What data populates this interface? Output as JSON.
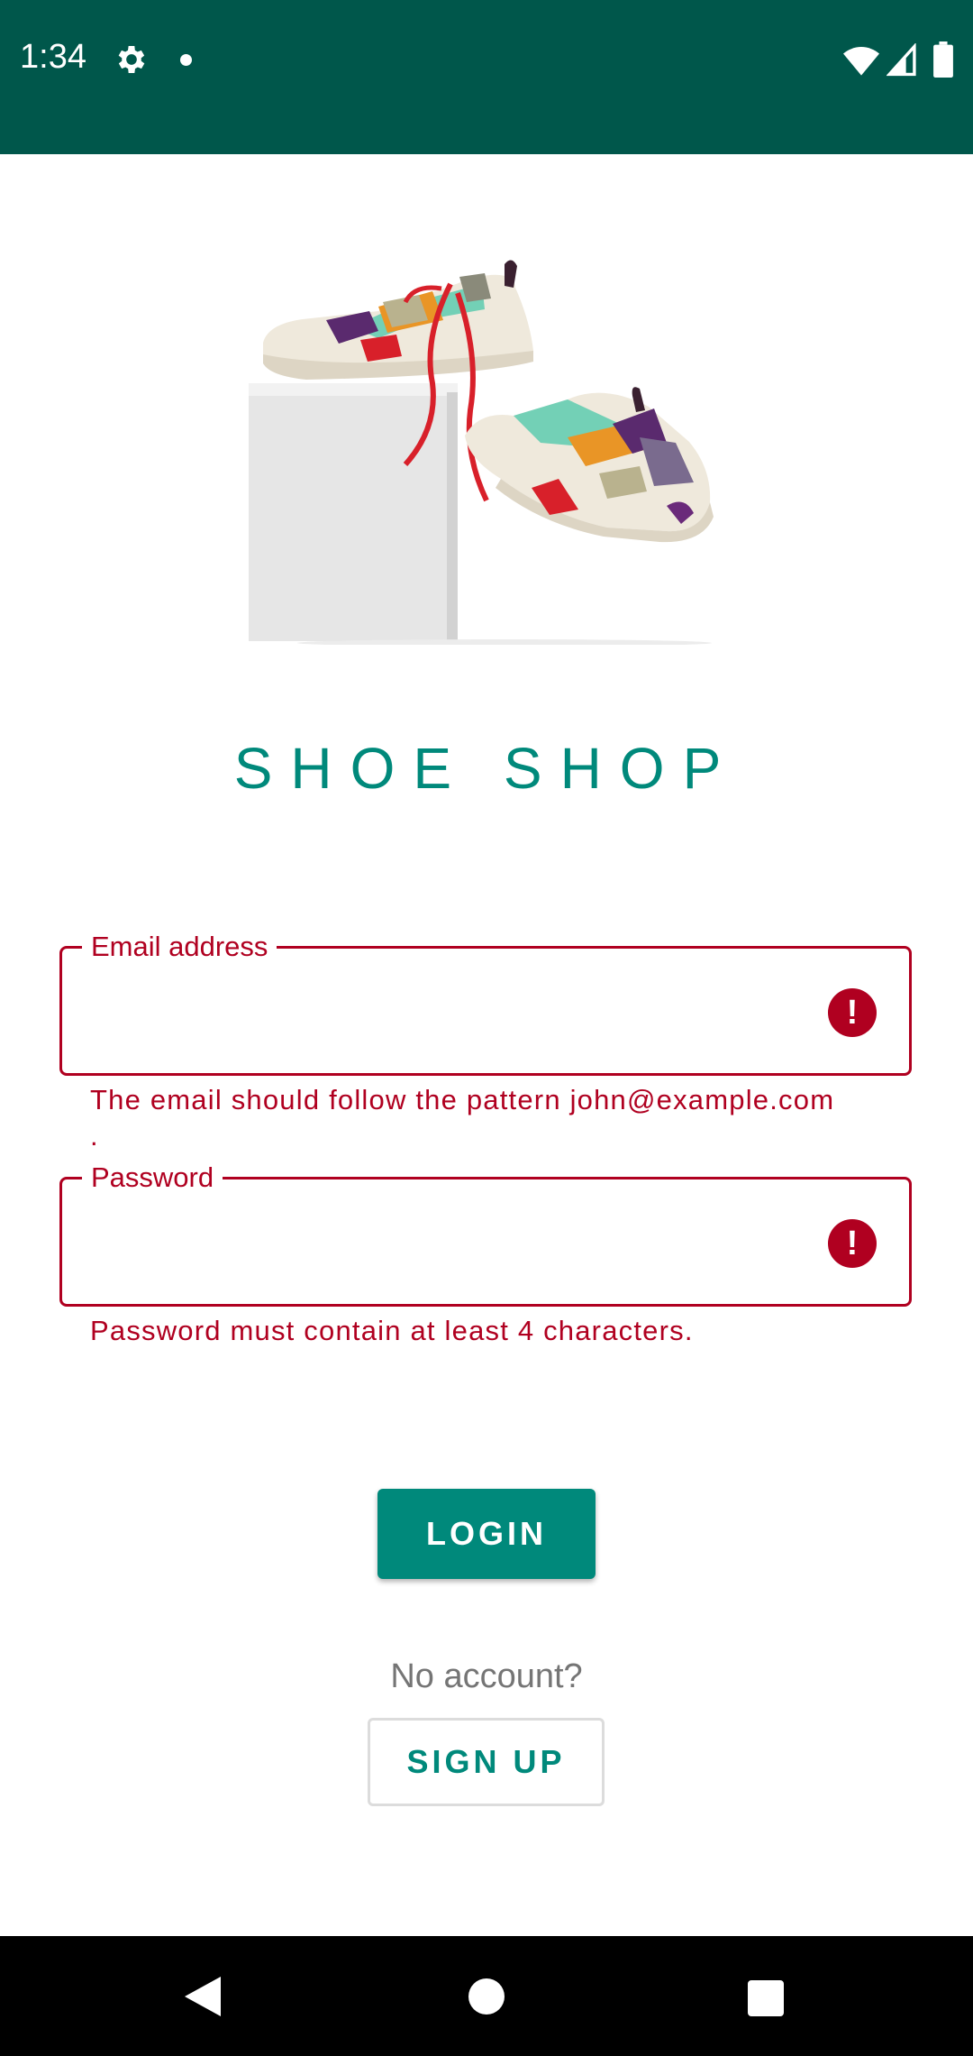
{
  "status_bar": {
    "time": "1:34",
    "icons": [
      "gear-icon",
      "notification-dot",
      "wifi-icon",
      "signal-icon",
      "battery-icon"
    ]
  },
  "app": {
    "title": "SHOE SHOP"
  },
  "form": {
    "email": {
      "label": "Email address",
      "value": "",
      "error": "The email should follow the pattern john@example.com\n."
    },
    "password": {
      "label": "Password",
      "value": "",
      "error": "Password must contain at least 4 characters."
    }
  },
  "actions": {
    "login_label": "LOGIN",
    "no_account_text": "No account?",
    "signup_label": "SIGN UP"
  },
  "colors": {
    "status_bar": "#00574b",
    "accent": "#00897b",
    "error": "#b00020"
  },
  "nav_bar": {
    "icons": [
      "back-icon",
      "home-icon",
      "recent-apps-icon"
    ]
  }
}
